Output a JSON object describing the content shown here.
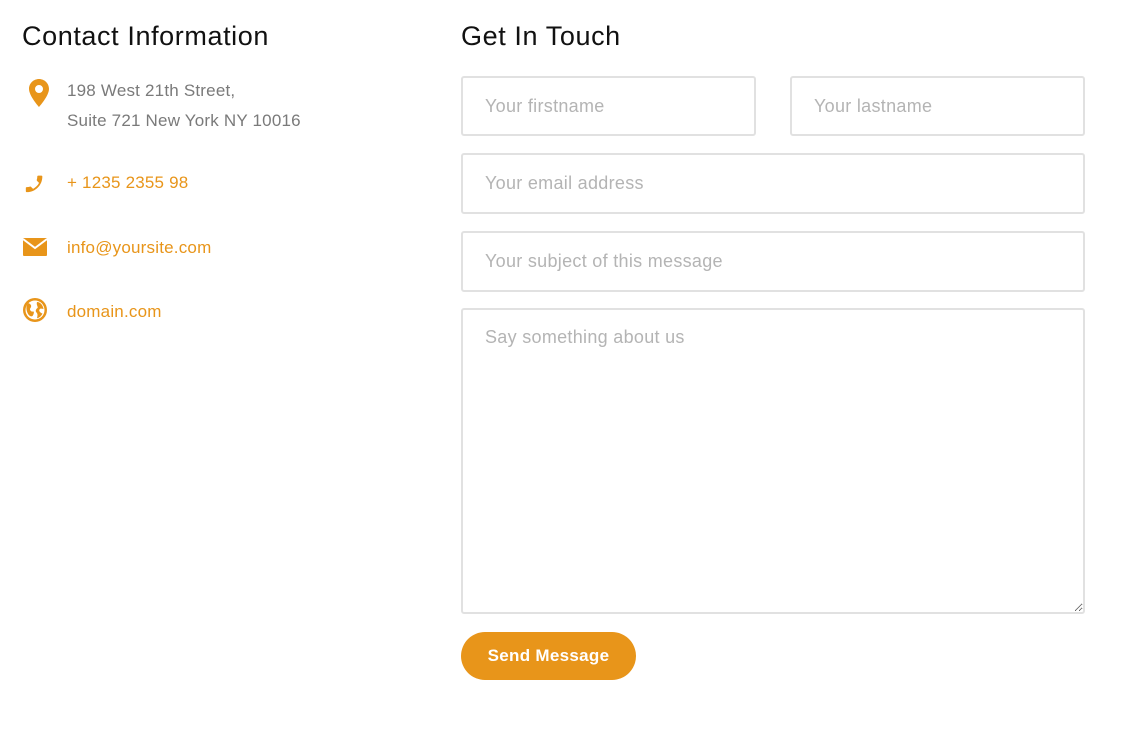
{
  "contact": {
    "title": "Contact Information",
    "address_line1": "198 West 21th Street,",
    "address_line2": "Suite 721 New York NY 10016",
    "phone": "+ 1235 2355 98",
    "email": "info@yoursite.com",
    "website": "domain.com",
    "icons": [
      "map-pin-icon",
      "phone-icon",
      "envelope-icon",
      "globe-icon"
    ]
  },
  "form": {
    "title": "Get In Touch",
    "firstname_placeholder": "Your firstname",
    "lastname_placeholder": "Your lastname",
    "email_placeholder": "Your email address",
    "subject_placeholder": "Your subject of this message",
    "message_placeholder": "Say something about us",
    "submit_label": "Send Message"
  },
  "colors": {
    "accent": "#e8951a",
    "muted_text": "#7a7a7a",
    "border": "#e1e1e1",
    "placeholder": "#b4b4b4"
  }
}
